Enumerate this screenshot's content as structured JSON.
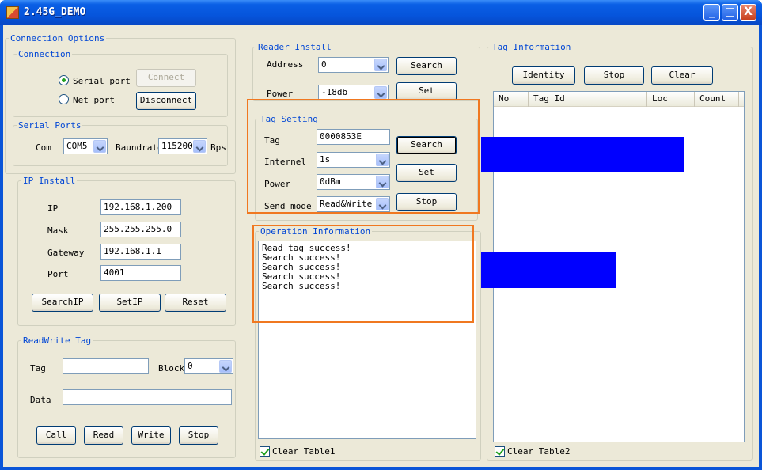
{
  "window": {
    "title": "2.45G_DEMO",
    "minimize": "_",
    "maximize": "□",
    "close": "X"
  },
  "connection_options": {
    "legend": "Connection Options",
    "connection": {
      "legend": "Connection",
      "serial_port": "Serial port",
      "net_port": "Net port",
      "selected": "serial_port",
      "connect": "Connect",
      "disconnect": "Disconnect"
    },
    "serial_ports": {
      "legend": "Serial Ports",
      "com_label": "Com",
      "com_value": "COM5",
      "baud_label": "Baundrate",
      "baud_value": "115200",
      "bps": "Bps"
    }
  },
  "ip_install": {
    "legend": "IP Install",
    "ip_label": "IP",
    "ip": "192.168.1.200",
    "mask_label": "Mask",
    "mask": "255.255.255.0",
    "gateway_label": "Gateway",
    "gateway": "192.168.1.1",
    "port_label": "Port",
    "port": "4001",
    "search_ip": "SearchIP",
    "set_ip": "SetIP",
    "reset": "Reset"
  },
  "read_write_tag": {
    "legend": "ReadWrite Tag",
    "tag_label": "Tag",
    "tag": "",
    "block_label": "Block",
    "block": "0",
    "data_label": "Data",
    "data": "",
    "call": "Call",
    "read": "Read",
    "write": "Write",
    "stop": "Stop"
  },
  "reader_install": {
    "legend": "Reader Install",
    "address_label": "Address",
    "address": "0",
    "power_label": "Power",
    "power": "-18db",
    "search": "Search",
    "set": "Set"
  },
  "tag_setting": {
    "legend": "Tag Setting",
    "tag_label": "Tag",
    "tag": "0000853E",
    "interval_label": "Internel",
    "interval": "1s",
    "power_label": "Power",
    "power": "0dBm",
    "send_mode_label": "Send mode",
    "send_mode": "Read&Write",
    "search": "Search",
    "set": "Set",
    "stop": "Stop"
  },
  "operation_information": {
    "legend": "Operation Information",
    "lines": [
      "Read tag success!",
      "Search success!",
      "Search success!",
      "Search success!",
      "Search success!"
    ],
    "clear_table1": "Clear Table1",
    "clear_table1_checked": true
  },
  "tag_information": {
    "legend": "Tag Information",
    "identity": "Identity",
    "stop": "Stop",
    "clear": "Clear",
    "columns": [
      "No",
      "Tag Id",
      "Loc",
      "Count"
    ],
    "clear_table2": "Clear Table2",
    "clear_table2_checked": true
  },
  "colors": {
    "titlebar": "#0655dc",
    "highlight_box": "#f07820",
    "redaction": "#0000ff",
    "legend_text": "#0046d5"
  }
}
